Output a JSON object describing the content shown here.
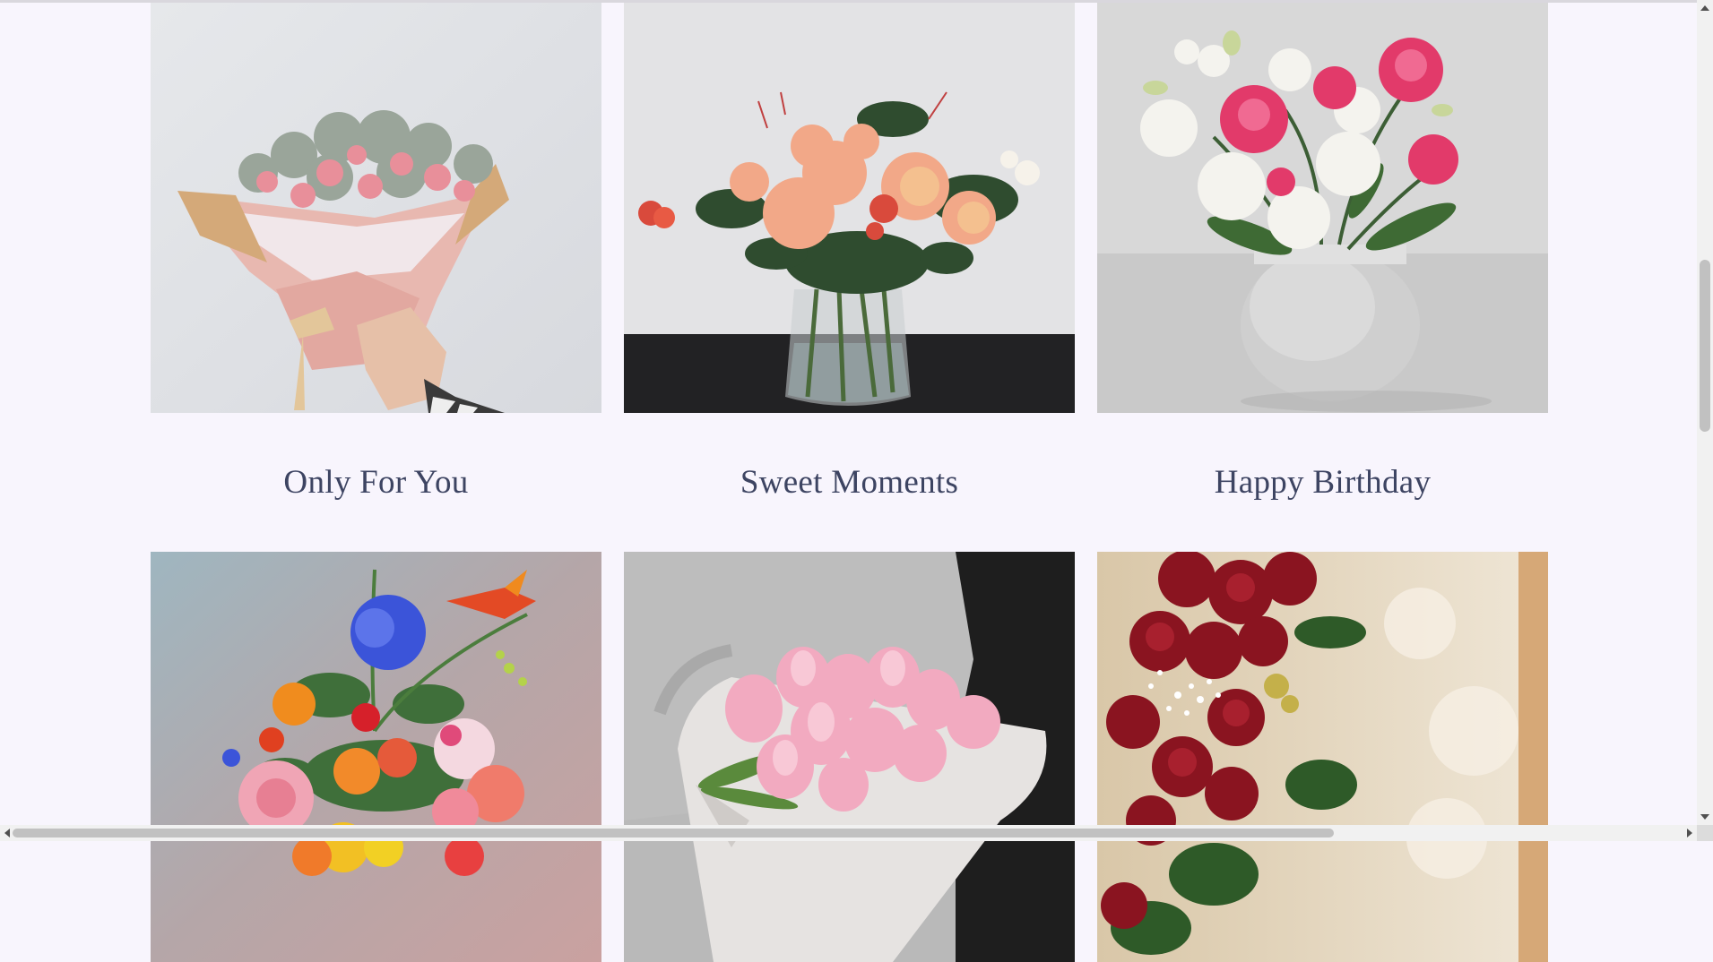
{
  "products": [
    {
      "title": "Only For You",
      "image_icon": "pink-bouquet-image"
    },
    {
      "title": "Sweet Moments",
      "image_icon": "peach-roses-vase-image"
    },
    {
      "title": "Happy Birthday",
      "image_icon": "white-pink-lisianthus-vase-image"
    },
    {
      "title": "",
      "image_icon": "colorful-mixed-bouquet-image"
    },
    {
      "title": "",
      "image_icon": "pink-tulips-bouquet-image"
    },
    {
      "title": "",
      "image_icon": "red-roses-bouquet-image"
    }
  ],
  "colors": {
    "background": "#f8f5fd",
    "caption_text": "#3d4462"
  }
}
